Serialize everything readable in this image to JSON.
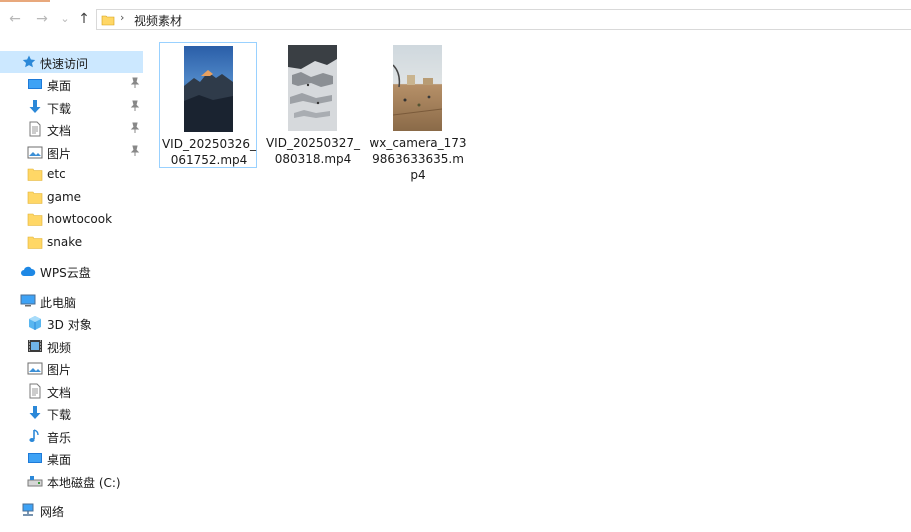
{
  "address_bar": {
    "path": "视频素材"
  },
  "nav": {
    "back_icon": "←",
    "forward_icon": "→",
    "dropdown_icon": "⌄",
    "up_icon": "↑"
  },
  "sidebar": {
    "quick_access": {
      "label": "快速访问",
      "items": [
        {
          "label": "桌面"
        },
        {
          "label": "下载"
        },
        {
          "label": "文档"
        },
        {
          "label": "图片"
        },
        {
          "label": "etc"
        },
        {
          "label": "game"
        },
        {
          "label": "howtocook"
        },
        {
          "label": "snake"
        }
      ]
    },
    "wps": {
      "label": "WPS云盘"
    },
    "this_pc": {
      "label": "此电脑",
      "items": [
        {
          "label": "3D 对象"
        },
        {
          "label": "视频"
        },
        {
          "label": "图片"
        },
        {
          "label": "文档"
        },
        {
          "label": "下载"
        },
        {
          "label": "音乐"
        },
        {
          "label": "桌面"
        },
        {
          "label": "本地磁盘 (C:)"
        }
      ]
    },
    "network": {
      "label": "网络"
    }
  },
  "files": [
    {
      "name": "VID_20250326_061752.mp4",
      "selected": true
    },
    {
      "name": "VID_20250327_080318.mp4",
      "selected": false
    },
    {
      "name": "wx_camera_1739863633635.mp4",
      "selected": false
    }
  ],
  "colors": {
    "selection": "#cce8ff",
    "folder": "#ffd766",
    "accent_blue": "#1e88e5"
  }
}
